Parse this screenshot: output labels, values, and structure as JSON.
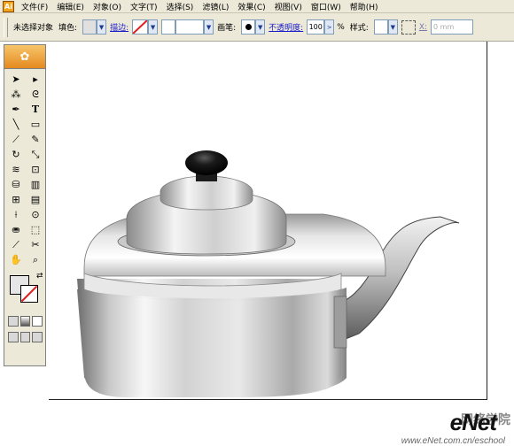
{
  "app": {
    "icon_glyph": "Ai"
  },
  "menu": {
    "items": [
      "文件(F)",
      "编辑(E)",
      "对象(O)",
      "文字(T)",
      "选择(S)",
      "滤镜(L)",
      "效果(C)",
      "视图(V)",
      "窗口(W)",
      "帮助(H)"
    ]
  },
  "control_bar": {
    "selection_status": "未选择对象",
    "fill_label": "填色:",
    "stroke_label": "描边:",
    "brush_label": "画笔:",
    "opacity_label": "不透明度:",
    "opacity_value": "100",
    "percent_sign": "%",
    "style_label": "样式:",
    "x_label": "X:",
    "x_value": "0 mm",
    "arrow_glyph": "▼",
    "stepper_glyph": ">"
  },
  "toolbox": {
    "tools": [
      "selection",
      "direct-selection",
      "magic-wand",
      "lasso",
      "pen",
      "type",
      "line",
      "rectangle",
      "paintbrush",
      "pencil",
      "rotate",
      "scale",
      "warp",
      "free-transform",
      "symbol-sprayer",
      "graph",
      "mesh",
      "gradient",
      "eyedropper",
      "blend",
      "live-paint",
      "live-paint-selection",
      "slice",
      "scissors",
      "hand",
      "zoom"
    ],
    "fill_color": "#e6e6e6",
    "stroke_color": "none"
  },
  "watermark": {
    "brand": "eNet",
    "chinese": "网络学院",
    "url": "www.eNet.com.cn/eschool"
  },
  "colors": {
    "ui_background": "#ece9d8",
    "link_blue": "#1a1acc",
    "kettle_knob": "#111111",
    "kettle_metal": "#c8c8c8"
  }
}
